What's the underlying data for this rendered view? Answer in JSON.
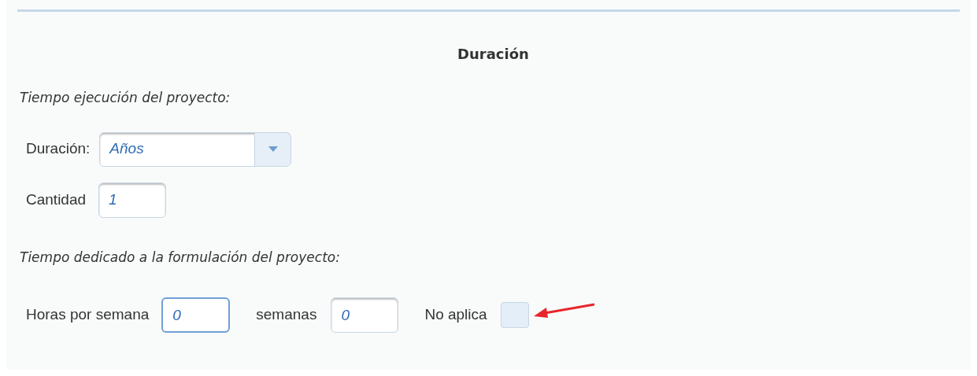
{
  "section": {
    "title": "Duración"
  },
  "execution": {
    "heading": "Tiempo ejecución del proyecto:",
    "duration": {
      "label": "Duración:",
      "value": "Años"
    },
    "quantity": {
      "label": "Cantidad",
      "value": "1"
    }
  },
  "formulation": {
    "heading": "Tiempo dedicado a la formulación del proyecto:",
    "hours": {
      "label": "Horas por semana",
      "value": "0",
      "focused": true
    },
    "weeks": {
      "label": "semanas",
      "value": "0",
      "focused": false
    },
    "not_applicable": {
      "label": "No aplica",
      "checked": false
    }
  }
}
